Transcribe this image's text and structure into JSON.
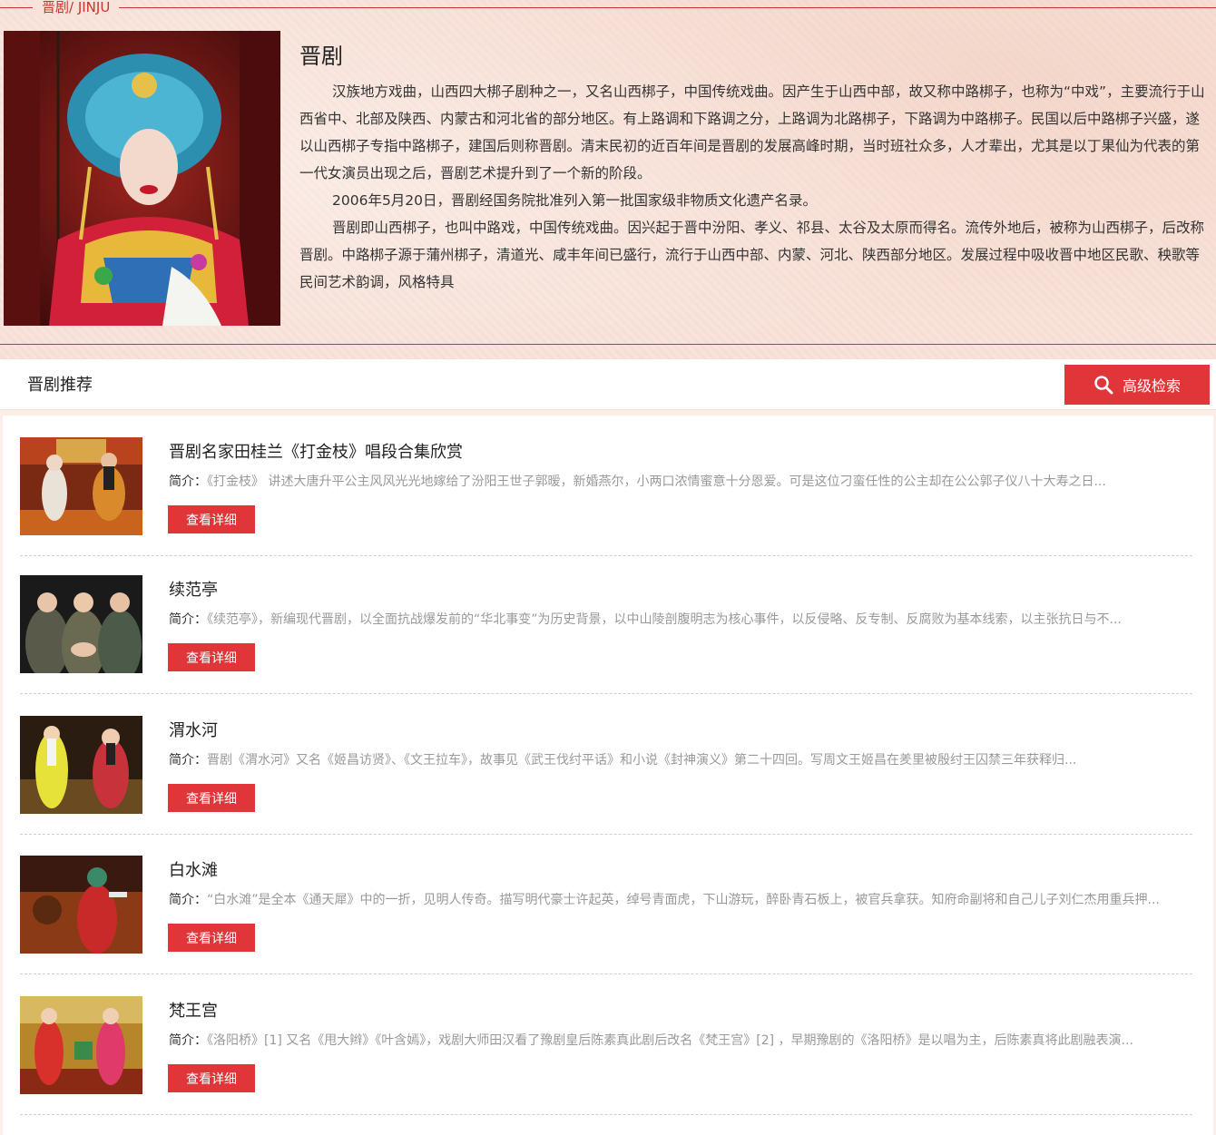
{
  "breadcrumb": "晋剧/ JINJU",
  "hero": {
    "title": "晋剧",
    "paragraphs": [
      "汉族地方戏曲，山西四大梆子剧种之一，又名山西梆子，中国传统戏曲。因产生于山西中部，故又称中路梆子，也称为“中戏”，主要流行于山西省中、北部及陕西、内蒙古和河北省的部分地区。有上路调和下路调之分，上路调为北路梆子，下路调为中路梆子。民国以后中路梆子兴盛，遂以山西梆子专指中路梆子，建国后则称晋剧。清末民初的近百年间是晋剧的发展高峰时期，当时班社众多，人才辈出，尤其是以丁果仙为代表的第一代女演员出现之后，晋剧艺术提升到了一个新的阶段。",
      "2006年5月20日，晋剧经国务院批准列入第一批国家级非物质文化遗产名录。",
      "晋剧即山西梆子，也叫中路戏，中国传统戏曲。因兴起于晋中汾阳、孝义、祁县、太谷及太原而得名。流传外地后，被称为山西梆子，后改称晋剧。中路梆子源于蒲州梆子，清道光、咸丰年间已盛行，流行于山西中部、内蒙、河北、陕西部分地区。发展过程中吸收晋中地区民歌、秧歌等民间艺术韵调，风格特具"
    ]
  },
  "recommend": {
    "title": "晋剧推荐",
    "search_button": "高级检索"
  },
  "items": [
    {
      "title": "晋剧名家田桂兰《打金枝》唱段合集欣赏",
      "desc_label": "简介：",
      "desc": "《打金枝》 讲述大唐升平公主风风光光地嫁给了汾阳王世子郭暧，新婚燕尔，小两口浓情蜜意十分恩爱。可是这位刁蛮任性的公主却在公公郭子仪八十大寿之日...",
      "button": "查看详细"
    },
    {
      "title": "续范亭",
      "desc_label": "简介：",
      "desc": "《续范亭》，新编现代晋剧，以全面抗战爆发前的“华北事变”为历史背景，以中山陵剖腹明志为核心事件，以反侵略、反专制、反腐败为基本线索，以主张抗日与不...",
      "button": "查看详细"
    },
    {
      "title": "渭水河",
      "desc_label": "简介：",
      "desc": "晋剧《渭水河》又名《姬昌访贤》、《文王拉车》，故事见《武王伐纣平话》和小说《封神演义》第二十四回。写周文王姬昌在羑里被殷纣王囚禁三年获释归...",
      "button": "查看详细"
    },
    {
      "title": "白水滩",
      "desc_label": "简介：",
      "desc": "“白水滩”是全本《通天犀》中的一折，见明人传奇。描写明代豪士许起英，绰号青面虎，下山游玩，醉卧青石板上，被官兵拿获。知府命副将和自己儿子刘仁杰用重兵押...",
      "button": "查看详细"
    },
    {
      "title": "梵王宫",
      "desc_label": "简介：",
      "desc": "《洛阳桥》[1] 又名《甩大辫》《叶含嫣》，戏剧大师田汉看了豫剧皇后陈素真此剧后改名《梵王宫》[2] ，早期豫剧的《洛阳桥》是以唱为主，后陈素真将此剧融表演...",
      "button": "查看详细"
    }
  ]
}
